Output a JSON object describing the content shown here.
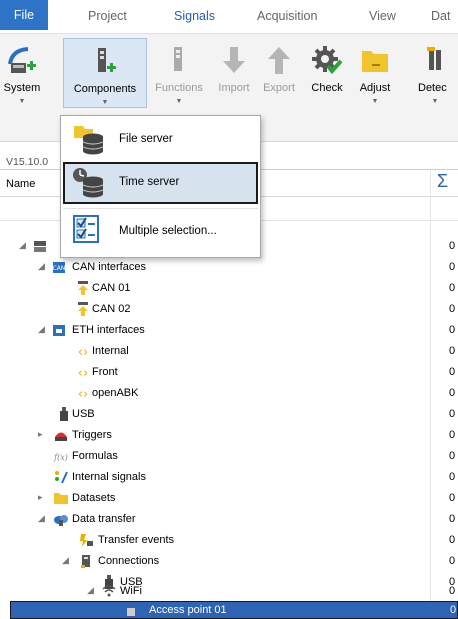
{
  "menubar": {
    "file": "File",
    "items": [
      "Project",
      "Signals",
      "Acquisition",
      "View",
      "Dat"
    ]
  },
  "ribbon": {
    "buttons": [
      "System",
      "Components",
      "Functions",
      "Import",
      "Export",
      "Check",
      "Adjust",
      "Detec"
    ]
  },
  "version": "V15.10.0",
  "table": {
    "name_header": "Name",
    "sum_header": "Σ"
  },
  "tree": [
    {
      "label": "",
      "count": "0",
      "icon": "network-icon"
    },
    {
      "label": "CAN interfaces",
      "count": "0",
      "icon": "can-icon"
    },
    {
      "label": "CAN 01",
      "count": "0",
      "icon": "can-port-icon"
    },
    {
      "label": "CAN 02",
      "count": "0",
      "icon": "can-port-icon"
    },
    {
      "label": "ETH interfaces",
      "count": "0",
      "icon": "eth-icon"
    },
    {
      "label": "Internal",
      "count": "0",
      "icon": "eth-port-icon"
    },
    {
      "label": "Front",
      "count": "0",
      "icon": "eth-port-icon"
    },
    {
      "label": "openABK",
      "count": "0",
      "icon": "eth-port-icon"
    },
    {
      "label": "USB",
      "count": "0",
      "icon": "usb-icon"
    },
    {
      "label": "Triggers",
      "count": "0",
      "icon": "trigger-icon"
    },
    {
      "label": "Formulas",
      "count": "0",
      "icon": "formula-icon"
    },
    {
      "label": "Internal signals",
      "count": "0",
      "icon": "signals-icon"
    },
    {
      "label": "Datasets",
      "count": "0",
      "icon": "folder-icon"
    },
    {
      "label": "Data transfer",
      "count": "0",
      "icon": "cloud-icon"
    },
    {
      "label": "Transfer events",
      "count": "0",
      "icon": "transfer-event-icon"
    },
    {
      "label": "Connections",
      "count": "0",
      "icon": "connections-icon"
    },
    {
      "label": "USB",
      "count": "0",
      "icon": "usb-icon"
    },
    {
      "label": "WiFi",
      "count": "0",
      "icon": "wifi-icon"
    },
    {
      "label": "Access point 01",
      "count": "0",
      "icon": "access-point-icon"
    }
  ],
  "dropdown": {
    "items": [
      "File server",
      "Time server",
      "Multiple selection..."
    ]
  },
  "colors": {
    "file_tab": "#2d73c8",
    "selection": "#2f64b4",
    "active_tab": "#2060b0"
  }
}
